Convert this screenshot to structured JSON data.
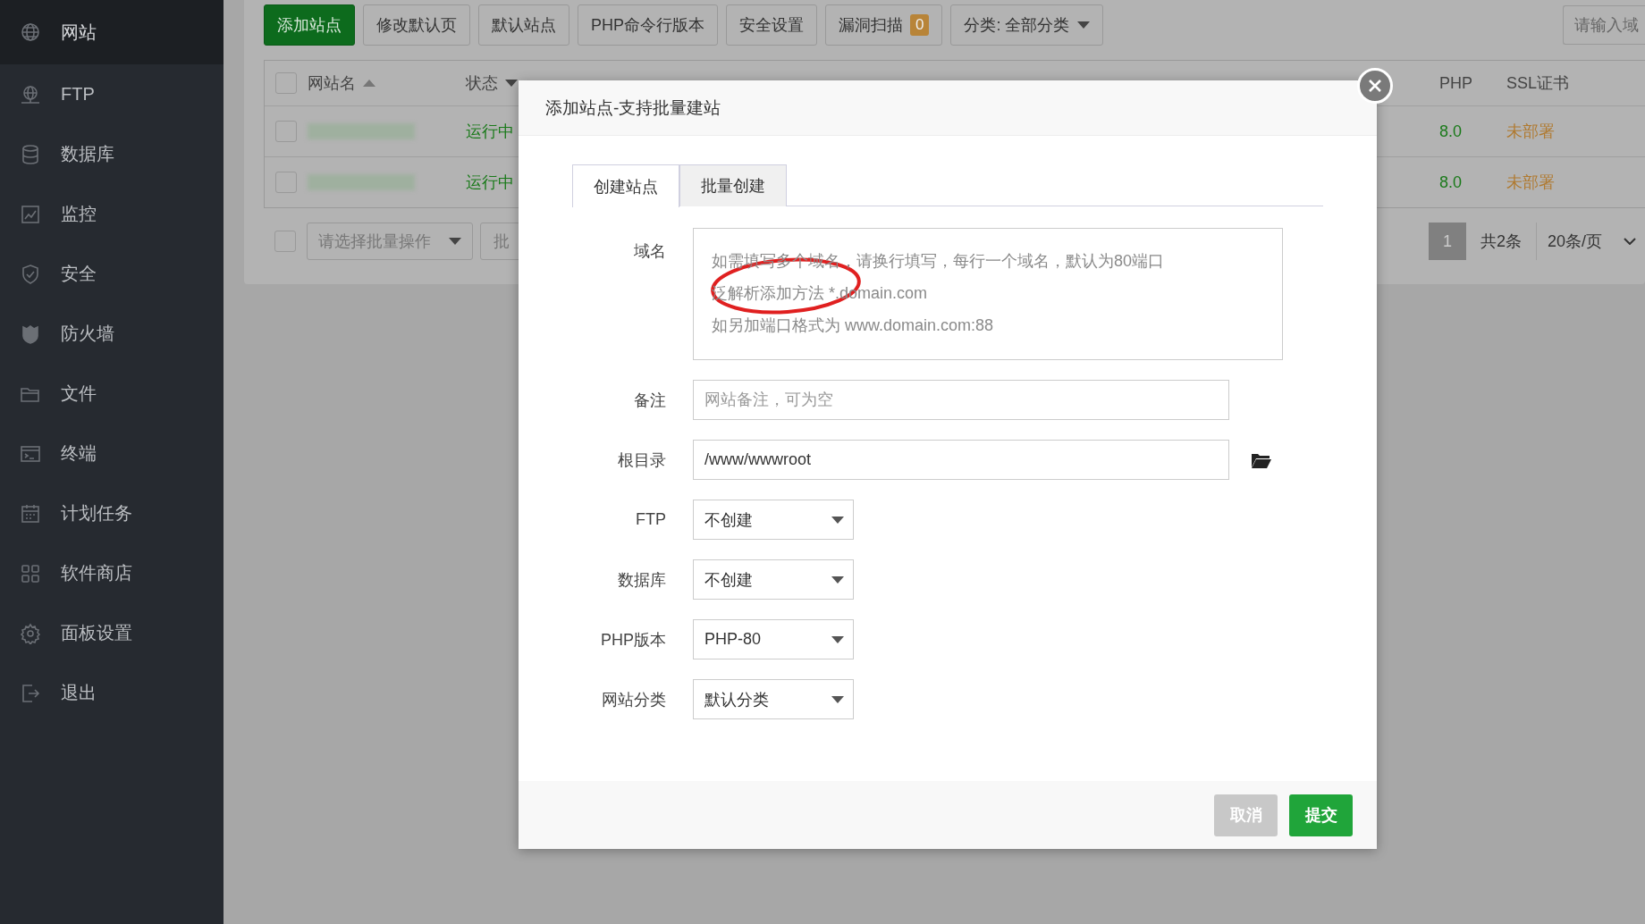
{
  "sidebar": {
    "items": [
      {
        "label": "网站",
        "selected": true
      },
      {
        "label": "FTP",
        "selected": false
      },
      {
        "label": "数据库",
        "selected": false
      },
      {
        "label": "监控",
        "selected": false
      },
      {
        "label": "安全",
        "selected": false
      },
      {
        "label": "防火墙",
        "selected": false
      },
      {
        "label": "文件",
        "selected": false
      },
      {
        "label": "终端",
        "selected": false
      },
      {
        "label": "计划任务",
        "selected": false
      },
      {
        "label": "软件商店",
        "selected": false
      },
      {
        "label": "面板设置",
        "selected": false
      },
      {
        "label": "退出",
        "selected": false
      }
    ]
  },
  "toolbar": {
    "buttons": [
      {
        "label": "添加站点",
        "kind": "primary"
      },
      {
        "label": "修改默认页",
        "kind": "default"
      },
      {
        "label": "默认站点",
        "kind": "default"
      },
      {
        "label": "PHP命令行版本",
        "kind": "default"
      },
      {
        "label": "安全设置",
        "kind": "default"
      },
      {
        "label": "漏洞扫描",
        "kind": "badge",
        "badge": "0"
      },
      {
        "label": "分类: 全部分类",
        "kind": "dropdown"
      }
    ],
    "search": {
      "placeholder": "请输入域"
    }
  },
  "table": {
    "columns": [
      {
        "label": "网站名",
        "sort_ascending": true
      },
      {
        "label": "状态",
        "sort_ascending": false
      },
      {
        "label": "PHP"
      },
      {
        "label": "SSL证书"
      }
    ],
    "header_checked": false,
    "rows": [
      {
        "checked": false,
        "status": "运行中",
        "php": "8.0",
        "ssl": "未部署"
      },
      {
        "checked": false,
        "status": "运行中",
        "php": "8.0",
        "ssl": "未部署"
      }
    ]
  },
  "table_footer": {
    "checked": false,
    "batch_placeholder": "请选择批量操作",
    "batch_button": "批",
    "page": "1",
    "total": "共2条",
    "per_page": "20条/页"
  },
  "modal": {
    "title": "添加站点-支持批量建站",
    "tabs": [
      {
        "label": "创建站点",
        "selected": true
      },
      {
        "label": "批量创建",
        "selected": false
      }
    ],
    "fields": [
      {
        "kind": "textarea",
        "label": "域名",
        "placeholder_lines": [
          "如需填写多个域名，请换行填写，每行一个域名，默认为80端口",
          "泛解析添加方法 *.domain.com",
          "如另加端口格式为 www.domain.com:88"
        ],
        "annotated": true
      },
      {
        "kind": "input",
        "label": "备注",
        "placeholder": "网站备注，可为空"
      },
      {
        "kind": "input",
        "label": "根目录",
        "value": "/www/wwwroot",
        "browse": true
      },
      {
        "kind": "select",
        "label": "FTP",
        "value": "不创建"
      },
      {
        "kind": "select",
        "label": "数据库",
        "value": "不创建"
      },
      {
        "kind": "select",
        "label": "PHP版本",
        "value": "PHP-80"
      },
      {
        "kind": "select",
        "label": "网站分类",
        "value": "默认分类"
      }
    ],
    "buttons": [
      {
        "label": "取消",
        "kind": "cancel"
      },
      {
        "label": "提交",
        "kind": "submit"
      }
    ]
  }
}
